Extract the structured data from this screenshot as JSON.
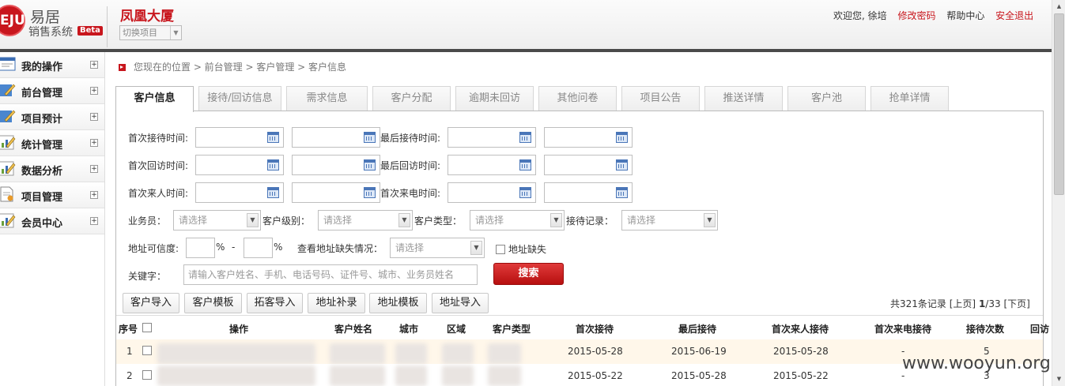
{
  "header": {
    "logo_badge": "EJU",
    "logo_name": "易居",
    "logo_sub": "销售系统",
    "beta": "Beta",
    "project_name": "凤凰大厦",
    "project_switch": "切换项目",
    "welcome": "欢迎您, 徐培",
    "links": [
      "修改密码",
      "帮助中心",
      "安全退出"
    ]
  },
  "sidebar": {
    "items": [
      {
        "label": "我的操作",
        "icon": "window-icon"
      },
      {
        "label": "前台管理",
        "icon": "pencil-icon"
      },
      {
        "label": "项目预计",
        "icon": "pencil-icon"
      },
      {
        "label": "统计管理",
        "icon": "chart-icon"
      },
      {
        "label": "数据分析",
        "icon": "chart-icon"
      },
      {
        "label": "项目管理",
        "icon": "document-icon"
      },
      {
        "label": "会员中心",
        "icon": "chart-icon"
      }
    ],
    "expand_glyph": "+"
  },
  "breadcrumb": {
    "prefix": "您现在的位置",
    "path": "您现在的位置 > 前台管理 > 客户管理 > 客户信息"
  },
  "tabs": [
    "客户信息",
    "接待/回访信息",
    "需求信息",
    "客户分配",
    "逾期未回访",
    "其他问卷",
    "项目公告",
    "推送详情",
    "客户池",
    "抢单详情"
  ],
  "filters": {
    "first_reception": "首次接待时间:",
    "last_reception": "最后接待时间:",
    "first_visit": "首次回访时间:",
    "last_visit": "最后回访时间:",
    "first_arrival": "首次来人时间:",
    "first_call": "首次来电时间:",
    "salesperson": "业务员：",
    "customer_level": "客户级别：",
    "customer_type": "客户类型：",
    "reception_record": "接待记录：",
    "select_placeholder": "请选择",
    "addr_confidence": "地址可信度:",
    "percent": "%",
    "dash": "-",
    "addr_missing_view": "查看地址缺失情况：",
    "addr_missing": "地址缺失",
    "keyword": "关键字：",
    "keyword_placeholder": "请输入客户姓名、手机、电话号码、证件号、城市、业务员姓名",
    "search": "搜索"
  },
  "toolbar": [
    "客户导入",
    "客户模板",
    "拓客导入",
    "地址补录",
    "地址模板",
    "地址导入"
  ],
  "pager": {
    "total": "共321条记录",
    "prev": "[上页]",
    "current": "1",
    "pages": "/33",
    "next": "[下页]"
  },
  "table": {
    "headers": [
      "序号",
      "操作",
      "客户姓名",
      "城市",
      "区域",
      "客户类型",
      "首次接待",
      "最后接待",
      "首次来人接待",
      "首次来电接待",
      "接待次数",
      "回访"
    ],
    "rows": [
      {
        "no": "1",
        "first": "2015-05-28",
        "last": "2015-06-19",
        "arrival": "2015-05-28",
        "call": "-",
        "count": "5"
      },
      {
        "no": "2",
        "first": "2015-05-22",
        "last": "2015-05-28",
        "arrival": "2015-05-22",
        "call": "-",
        "count": "3"
      }
    ]
  },
  "watermark": "www.wooyun.org",
  "colors": {
    "brand_red": "#c8161d",
    "row_highlight": "#fff7ea"
  }
}
